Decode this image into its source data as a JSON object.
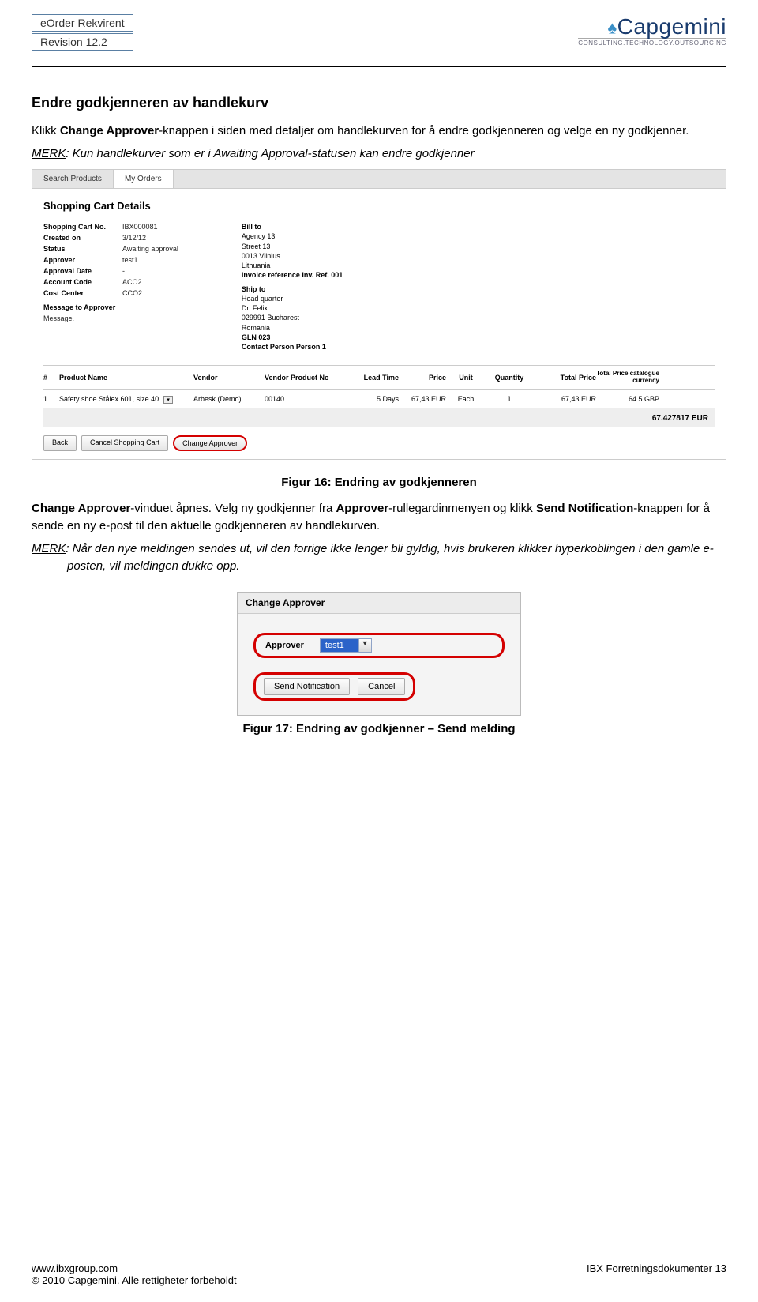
{
  "header": {
    "title": "eOrder Rekvirent",
    "revision": "Revision 12.2",
    "logo_text": "Capgemini",
    "logo_tagline": "CONSULTING.TECHNOLOGY.OUTSOURCING"
  },
  "heading": "Endre godkjenneren av handlekurv",
  "paras": {
    "p1_a": "Klikk ",
    "p1_b": "Change Approver",
    "p1_c": "-knappen i siden med detaljer om handlekurven for å endre godkjenneren og velge en ny godkjenner.",
    "merk1_label": "MERK",
    "merk1_body": ": Kun handlekurver som er i Awaiting Approval-statusen kan endre godkjenner"
  },
  "shot1": {
    "tab1": "Search Products",
    "tab2": "My Orders",
    "h": "Shopping Cart Details",
    "labels": {
      "cartno": "Shopping Cart No.",
      "created": "Created on",
      "status": "Status",
      "approver": "Approver",
      "appdate": "Approval Date",
      "account": "Account Code",
      "cost": "Cost Center",
      "msg": "Message to Approver"
    },
    "vals": {
      "cartno": "IBX000081",
      "created": "3/12/12",
      "status": "Awaiting approval",
      "approver": "test1",
      "appdate": "-",
      "account": "ACO2",
      "cost": "CCO2",
      "msg": "Message.",
      "billto_h": "Bill to",
      "billto_1": "Agency 13",
      "billto_2": "Street 13",
      "billto_3": "0013 Vilnius",
      "billto_4": "Lithuania",
      "inv": "Invoice reference Inv. Ref. 001",
      "shipto_h": "Ship to",
      "ship_1": "Head quarter",
      "ship_2": "Dr. Felix",
      "ship_3": "029991 Bucharest",
      "ship_4": "Romania",
      "ship_5": "GLN 023",
      "contact": "Contact Person Person 1"
    },
    "thead": {
      "num": "#",
      "name": "Product Name",
      "vendor": "Vendor",
      "vpn": "Vendor Product No",
      "lead": "Lead Time",
      "price": "Price",
      "unit": "Unit",
      "qty": "Quantity",
      "total": "Total Price",
      "totalcat": "Total Price catalogue currency"
    },
    "row": {
      "num": "1",
      "name": "Safety shoe Stålex 601, size 40",
      "vendor": "Arbesk (Demo)",
      "vpn": "00140",
      "lead": "5 Days",
      "price": "67,43 EUR",
      "unit": "Each",
      "qty": "1",
      "total": "67,43 EUR",
      "totalcat": "64.5 GBP"
    },
    "grand": "67.427817 EUR",
    "btn_back": "Back",
    "btn_cancel": "Cancel Shopping Cart",
    "btn_change": "Change Approver"
  },
  "fig16": "Figur 16: Endring av godkjenneren",
  "mid": {
    "a": "Change Approver",
    "b": "-vinduet åpnes. Velg ny godkjenner fra ",
    "c": "Approver",
    "d": "-rullegardinmenyen og klikk ",
    "e": "Send Notification",
    "f": "-knappen for å sende en ny e-post til den aktuelle godkjenneren av handlekurven."
  },
  "merk2": {
    "label": "MERK",
    "body": ": Når den nye meldingen sendes ut, vil den forrige ikke lenger bli gyldig, hvis brukeren klikker hyperkoblingen i den gamle e-posten, vil meldingen dukke opp."
  },
  "shot2": {
    "title": "Change Approver",
    "approver_label": "Approver",
    "approver_val": "test1",
    "btn_send": "Send Notification",
    "btn_cancel": "Cancel"
  },
  "fig17": "Figur 17: Endring av godkjenner – Send melding",
  "footer": {
    "url": "www.ibxgroup.com",
    "right": "IBX Forretningsdokumenter 13",
    "copy": "© 2010 Capgemini. Alle rettigheter forbeholdt"
  }
}
